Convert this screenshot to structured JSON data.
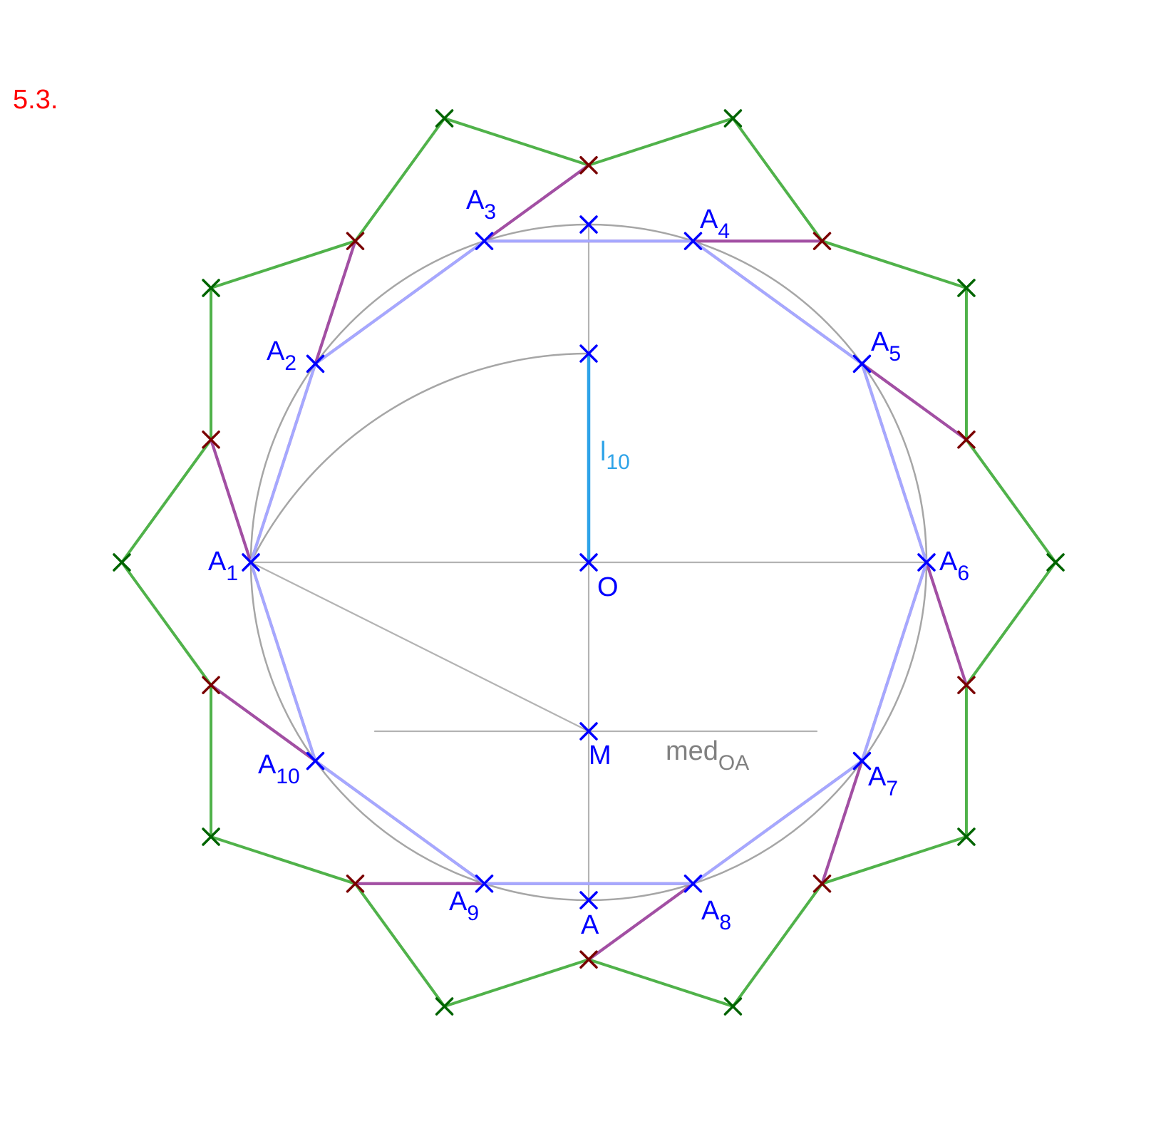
{
  "figure": {
    "title": "5.3.",
    "colors": {
      "title": "#ff0000",
      "construction": "#b3b3b3",
      "circle": "#a6a6a6",
      "decagon": "#a5a8ff",
      "star_inner": "#a24fa3",
      "star_outer": "#50b24a",
      "segment": "#2ea3e8",
      "point": "#0000ff",
      "inner_marker": "#7a0000",
      "outer_marker": "#006400",
      "label": "#0000ff",
      "segment_label": "#2ea3e8",
      "line_label": "#808080"
    },
    "points": {
      "A1": {
        "name": "A",
        "sub": "1"
      },
      "A2": {
        "name": "A",
        "sub": "2"
      },
      "A3": {
        "name": "A",
        "sub": "3"
      },
      "A4": {
        "name": "A",
        "sub": "4"
      },
      "A5": {
        "name": "A",
        "sub": "5"
      },
      "A6": {
        "name": "A",
        "sub": "6"
      },
      "A7": {
        "name": "A",
        "sub": "7"
      },
      "A8": {
        "name": "A",
        "sub": "8"
      },
      "A9": {
        "name": "A",
        "sub": "9"
      },
      "A10": {
        "name": "A",
        "sub": "10"
      },
      "O": {
        "name": "O"
      },
      "M": {
        "name": "M"
      },
      "A": {
        "name": "A"
      }
    },
    "segment_label": {
      "name": "l",
      "sub": "10"
    },
    "line_label": {
      "name": "med",
      "sub": "OA"
    }
  }
}
